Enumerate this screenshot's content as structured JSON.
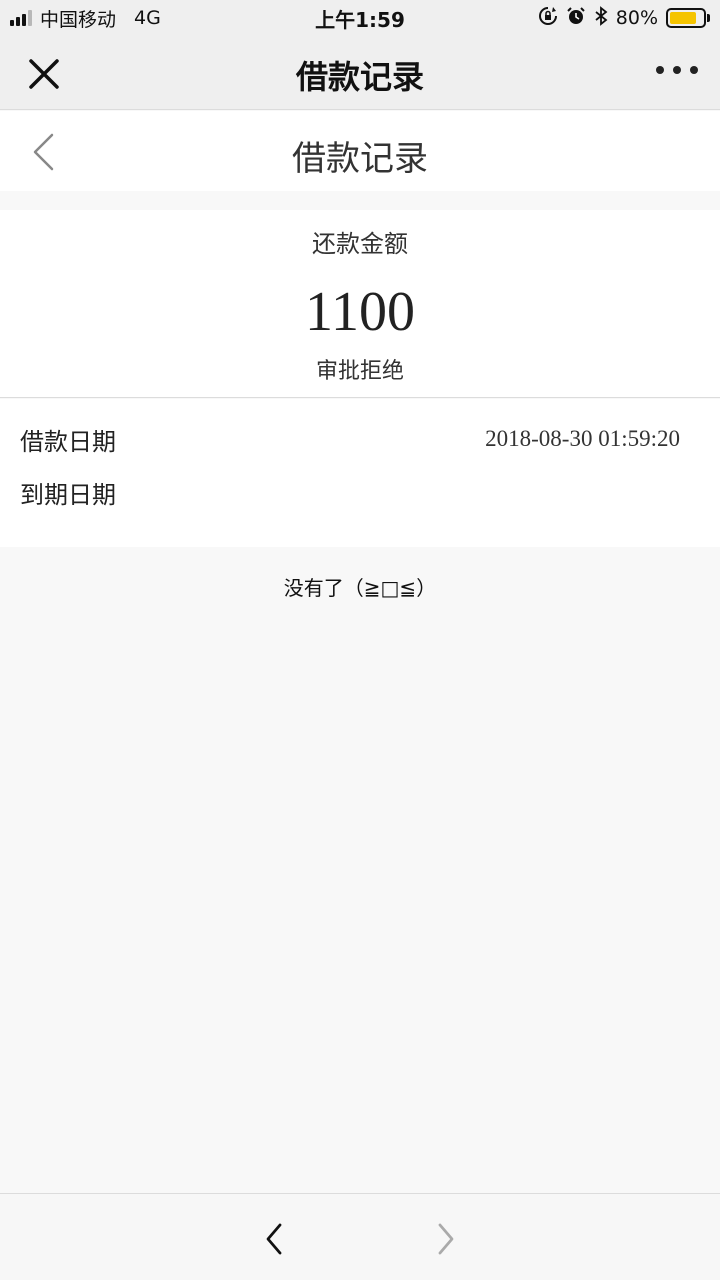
{
  "status_bar": {
    "carrier": "中国移动",
    "network": "4G",
    "time": "上午1:59",
    "battery_percent": "80%",
    "battery_level": 0.8,
    "icons": [
      "rotation-lock-icon",
      "alarm-icon",
      "bluetooth-icon"
    ],
    "battery_color": "#f5c400"
  },
  "wx_nav": {
    "title": "借款记录",
    "close_icon": "close-icon",
    "more_icon": "more-icon"
  },
  "page": {
    "title": "借款记录",
    "back_icon": "chevron-left-icon"
  },
  "summary": {
    "label": "还款金额",
    "amount": "1100",
    "status": "审批拒绝"
  },
  "details": [
    {
      "label": "借款日期",
      "value": "2018-08-30 01:59:20"
    },
    {
      "label": "到期日期",
      "value": ""
    }
  ],
  "end_text": "没有了（≧□≦）",
  "bottom_bar": {
    "back_icon": "chevron-left-icon",
    "forward_icon": "chevron-right-icon"
  }
}
